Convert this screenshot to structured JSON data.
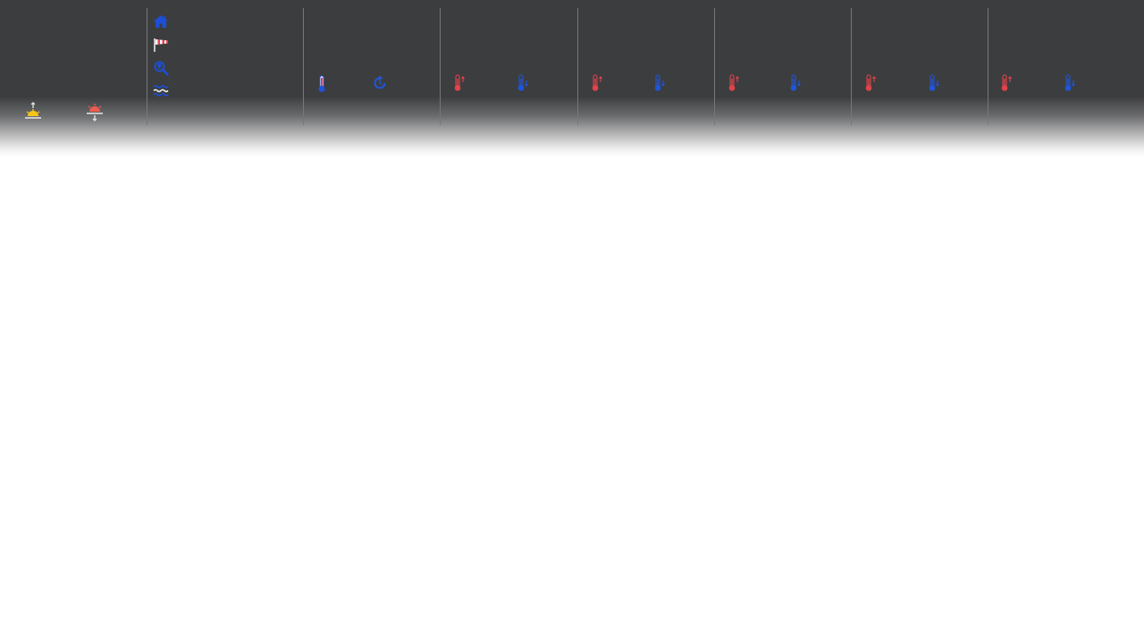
{
  "colors": {
    "bar_background": "#3c3d3f",
    "divider": "#76777a",
    "nav_icon_blue": "#1d4fd6",
    "warm_red": "#e2434b",
    "cold_blue": "#1f55d8",
    "sun_yellow": "#f5c518",
    "sunset_red": "#ee5a4f"
  },
  "sun_panel": {
    "sunrise_icon": "sunrise-icon",
    "sunset_icon": "sunset-icon"
  },
  "nav_menu": {
    "items": [
      "home-icon",
      "windsock-icon",
      "location-search-icon",
      "sea-waves-icon"
    ]
  },
  "current_panel": {
    "temperature_icon": "thermometer-icon",
    "refresh_icon": "refresh-icon"
  },
  "forecast_days": [
    {
      "max_icon": "thermometer-high-icon",
      "min_icon": "thermometer-low-icon"
    },
    {
      "max_icon": "thermometer-high-icon",
      "min_icon": "thermometer-low-icon"
    },
    {
      "max_icon": "thermometer-high-icon",
      "min_icon": "thermometer-low-icon"
    },
    {
      "max_icon": "thermometer-high-icon",
      "min_icon": "thermometer-low-icon"
    },
    {
      "max_icon": "thermometer-high-icon",
      "min_icon": "thermometer-low-icon"
    }
  ]
}
